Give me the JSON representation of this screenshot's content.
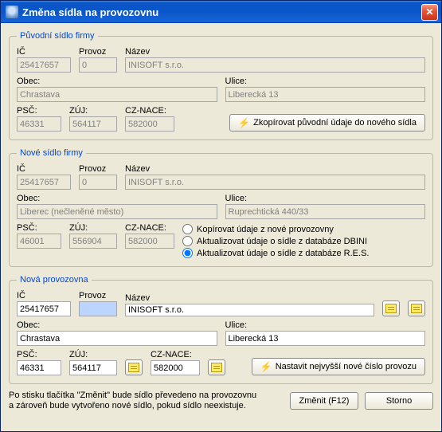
{
  "window": {
    "title": "Změna sídla na provozovnu"
  },
  "groups": {
    "puvodni": {
      "legend": "Původní sídlo firmy",
      "ic_label": "IČ",
      "ic": "25417657",
      "provoz_label": "Provoz",
      "provoz": "0",
      "nazev_label": "Název",
      "nazev": "INISOFT s.r.o.",
      "obec_label": "Obec:",
      "obec": "Chrastava",
      "ulice_label": "Ulice:",
      "ulice": "Liberecká 13",
      "psc_label": "PSČ:",
      "psc": "46331",
      "zuj_label": "ZÚJ:",
      "zuj": "564117",
      "cznace_label": "CZ-NACE:",
      "cznace": "582000",
      "copy_btn": "Zkopírovat původní údaje do nového sídla"
    },
    "nove": {
      "legend": "Nové sídlo firmy",
      "ic_label": "IČ",
      "ic": "25417657",
      "provoz_label": "Provoz",
      "provoz": "0",
      "nazev_label": "Název",
      "nazev": "INISOFT s.r.o.",
      "obec_label": "Obec:",
      "obec": "Liberec (nečleněné město)",
      "ulice_label": "Ulice:",
      "ulice": "Ruprechtická 440/33",
      "psc_label": "PSČ:",
      "psc": "46001",
      "zuj_label": "ZÚJ:",
      "zuj": "556904",
      "cznace_label": "CZ-NACE:",
      "cznace": "582000",
      "radios": {
        "r1": "Kopírovat údaje z nové provozovny",
        "r2": "Aktualizovat údaje o sídle z databáze DBINI",
        "r3": "Aktualizovat údaje o sídle z databáze R.E.S."
      },
      "selected_radio": "r3"
    },
    "prov": {
      "legend": "Nová provozovna",
      "ic_label": "IČ",
      "ic": "25417657",
      "provoz_label": "Provoz",
      "provoz": "",
      "nazev_label": "Název",
      "nazev": "INISOFT s.r.o.",
      "obec_label": "Obec:",
      "obec": "Chrastava",
      "ulice_label": "Ulice:",
      "ulice": "Liberecká 13",
      "psc_label": "PSČ:",
      "psc": "46331",
      "zuj_label": "ZÚJ:",
      "zuj": "564117",
      "cznace_label": "CZ-NACE:",
      "cznace": "582000",
      "set_btn": "Nastavit nejvyšší nové číslo provozu"
    }
  },
  "footer": {
    "note": "Po stisku tlačítka \"Změnit\" bude sídlo převedeno na provozovnu\na zároveň bude vytvořeno nové sídlo, pokud sídlo neexistuje.",
    "ok": "Změnit (F12)",
    "cancel": "Storno"
  }
}
